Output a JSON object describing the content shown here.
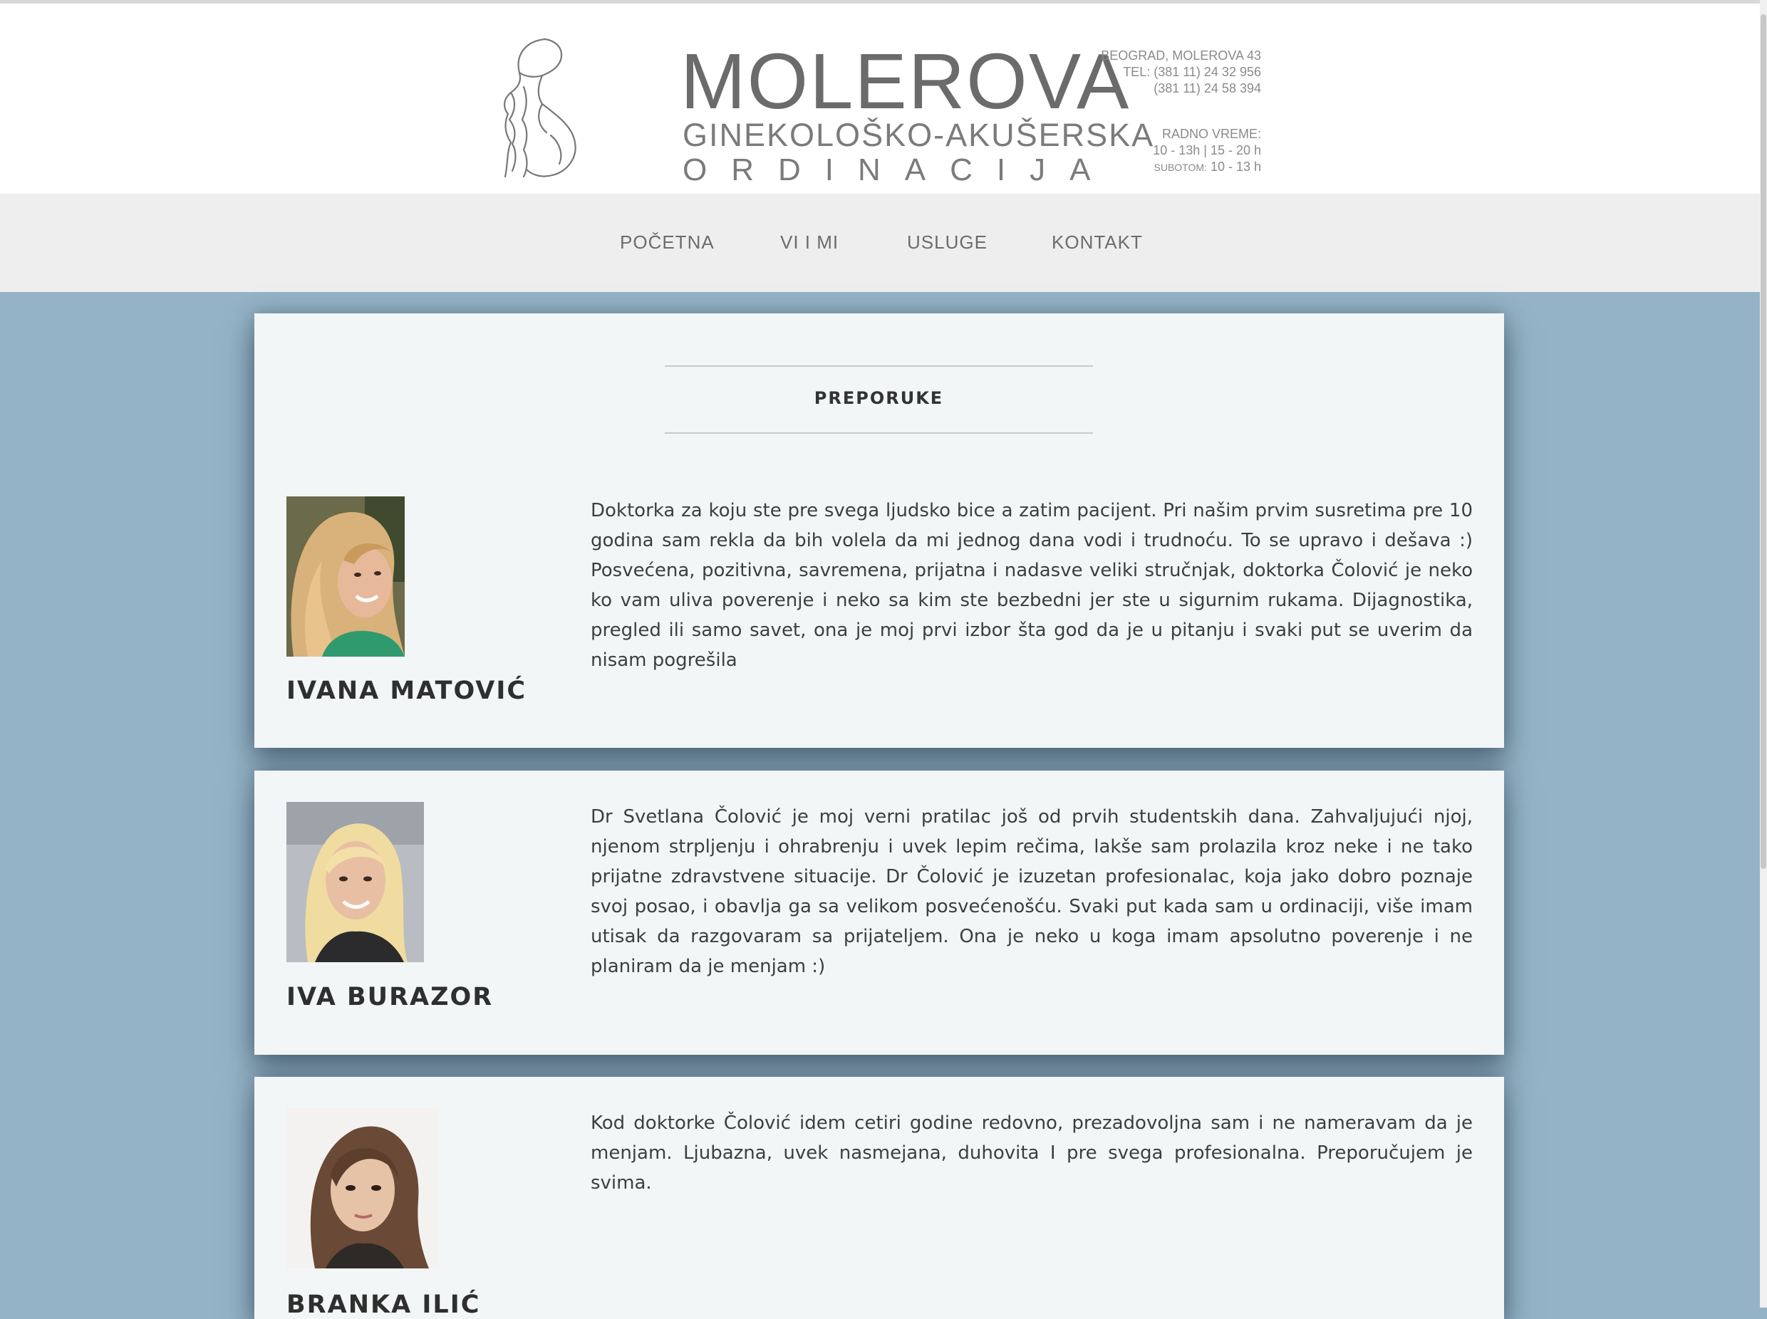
{
  "header": {
    "brand_name": "MOLEROVA",
    "brand_sub1": "GINEKOLOŠKO-AKUŠERSKA",
    "brand_sub2": "ORDINACIJA",
    "address": "BEOGRAD, MOLEROVA 43",
    "phone1": "TEL: (381 11) 24 32 956",
    "phone2": "(381 11) 24 58 394",
    "hours_title": "RADNO VREME:",
    "hours_week": "10 - 13h | 15 - 20 h",
    "hours_saturday_label": "SUBOTOM:",
    "hours_saturday": "10 - 13 h"
  },
  "nav": {
    "items": [
      {
        "label": "POČETNA"
      },
      {
        "label": "VI I MI"
      },
      {
        "label": "USLUGE"
      },
      {
        "label": "KONTAKT"
      }
    ]
  },
  "section": {
    "title": "PREPORUKE"
  },
  "testimonials": [
    {
      "name": "IVANA MATOVIĆ",
      "text": "Doktorka za koju ste pre svega ljudsko bice a zatim pacijent. Pri našim prvim susretima pre 10 godina sam rekla da bih volela da mi jednog dana vodi i trudnoću. To se upravo i dešava :) Posvećena, pozitivna, savremena, prijatna i nadasve veliki stručnjak, doktorka Čolović je neko ko vam uliva poverenje i neko sa kim ste bezbedni jer ste u sigurnim rukama. Dijagnostika, pregled ili samo savet, ona je moj prvi izbor šta god da je u pitanju i svaki put se uverim da nisam pogrešila"
    },
    {
      "name": "IVA BURAZOR",
      "text": "Dr Svetlana Čolović je moj verni pratilac još od prvih studentskih dana. Zahvaljujući njoj, njenom strpljenju i ohrabrenju i uvek lepim rečima, lakše sam prolazila kroz neke i ne tako prijatne zdravstvene situacije. Dr Čolović je izuzetan profesionalac, koja jako dobro poznaje svoj posao, i obavlja ga sa velikom posvećenošću. Svaki put kada sam u ordinaciji, više imam utisak da razgovaram sa prijateljem. Ona je neko u koga imam apsolutno poverenje i ne planiram da je menjam :)"
    },
    {
      "name": "BRANKA ILIĆ",
      "text": "Kod doktorke Čolović idem cetiri godine redovno, prezadovoljna sam i ne nameravam da je menjam. Ljubazna, uvek nasmejana, duhovita I pre svega profesionalna. Preporučujem je svima."
    }
  ]
}
